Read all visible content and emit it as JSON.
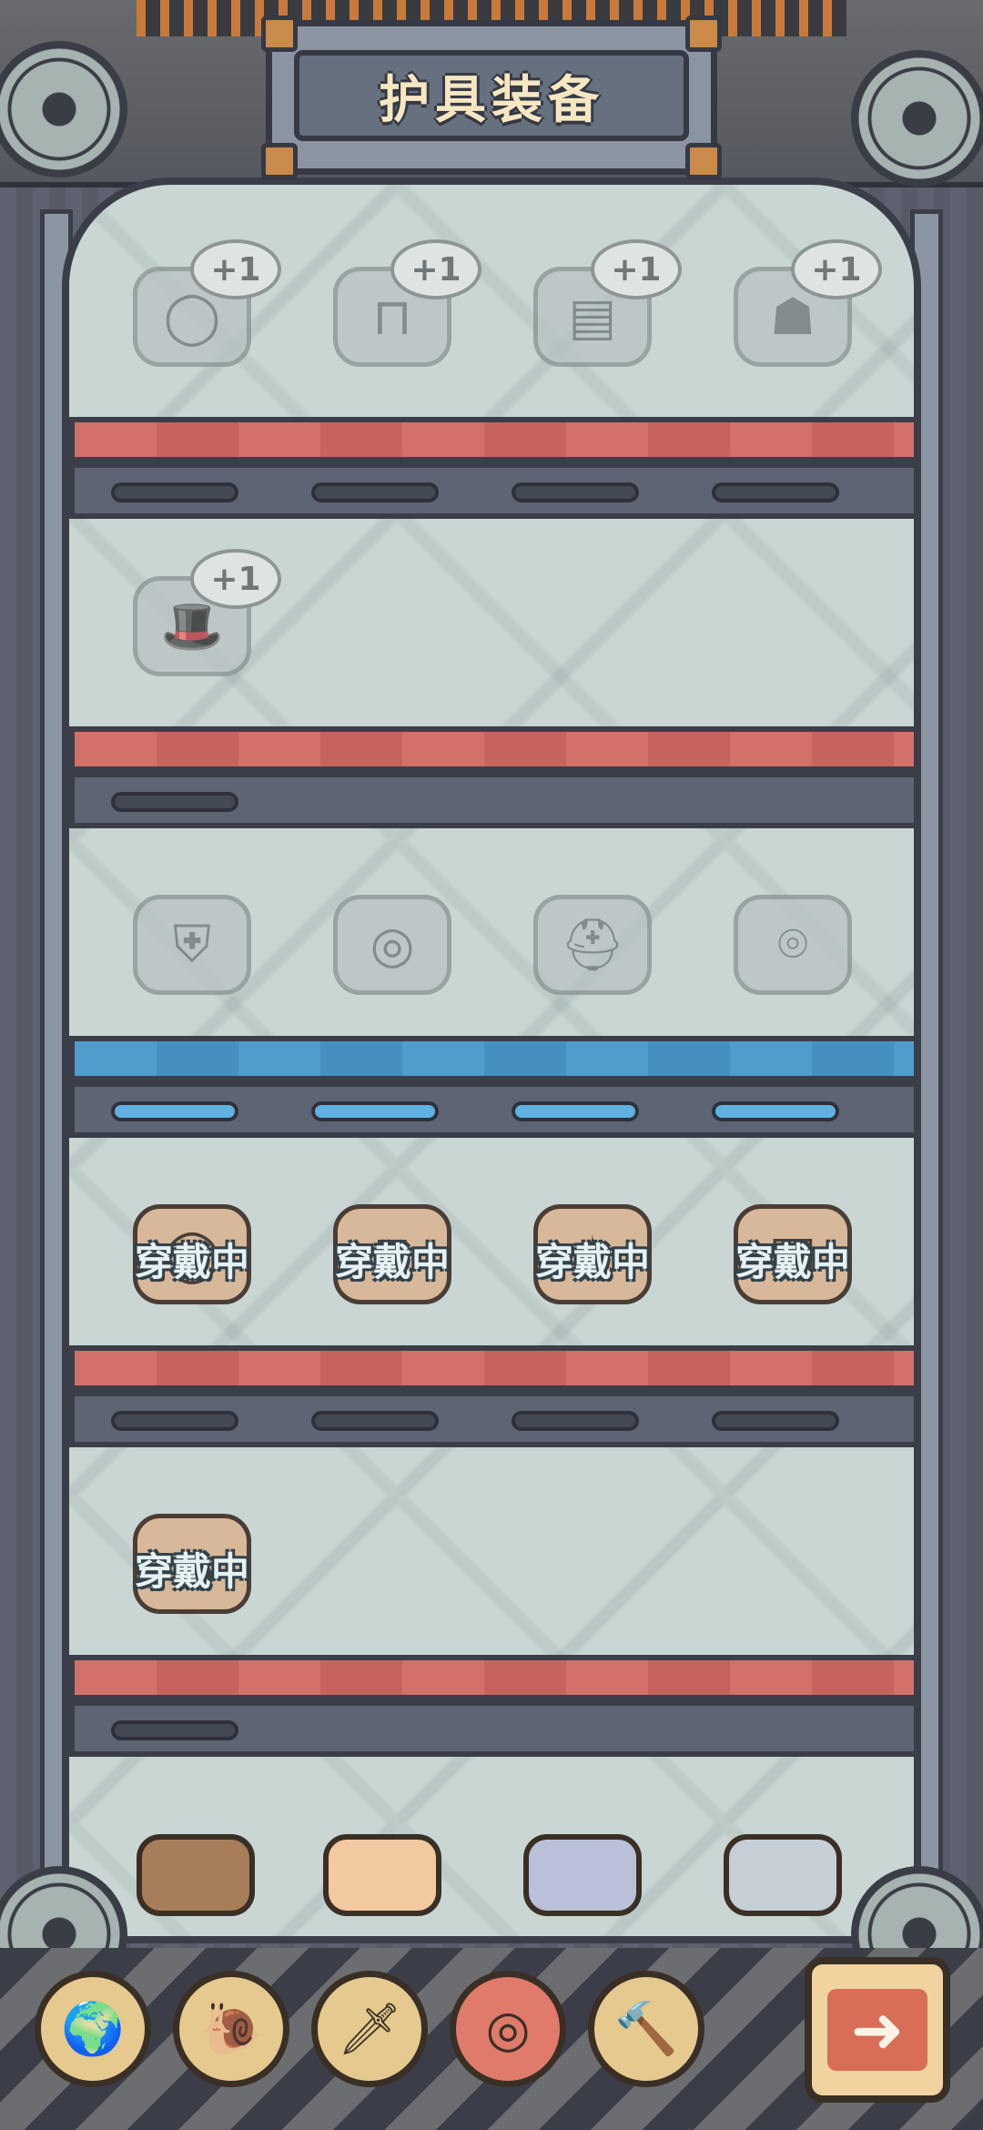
{
  "header": {
    "title": "护具装备"
  },
  "shelves": [
    {
      "board_color": "red",
      "slots": [
        {
          "name": "ring",
          "badge": "+1",
          "icon": "ring-icon"
        },
        {
          "name": "pants",
          "badge": "+1",
          "icon": "pants-icon"
        },
        {
          "name": "device",
          "badge": "+1",
          "icon": "device-icon"
        },
        {
          "name": "shirt",
          "badge": "+1",
          "icon": "shirt-icon"
        }
      ],
      "bars": [
        false,
        false,
        false,
        false
      ]
    },
    {
      "board_color": "red",
      "slots": [
        {
          "name": "top-hat",
          "badge": "+1",
          "icon": "hat-icon"
        }
      ],
      "bars": [
        false
      ]
    },
    {
      "board_color": "blue",
      "slots": [
        {
          "name": "armor",
          "icon": "armor-icon"
        },
        {
          "name": "swim-ring",
          "icon": "swim-ring-icon"
        },
        {
          "name": "viking-helmet",
          "icon": "helmet-icon"
        },
        {
          "name": "bracelet",
          "icon": "bracelet-icon"
        }
      ],
      "bars": [
        true,
        true,
        true,
        true
      ]
    },
    {
      "board_color": "red",
      "slots": [
        {
          "name": "ring-equipped",
          "label": "穿戴中",
          "icon": "ring-icon"
        },
        {
          "name": "pants-equipped",
          "label": "穿戴中",
          "icon": "pants-icon"
        },
        {
          "name": "wings-equipped",
          "label": "穿戴中",
          "icon": "wings-icon"
        },
        {
          "name": "device-equipped",
          "label": "穿戴中",
          "icon": "device-icon"
        }
      ],
      "bars": [
        false,
        false,
        false,
        false
      ]
    },
    {
      "board_color": "red",
      "slots": [
        {
          "name": "cake-equipped",
          "label": "穿戴中",
          "icon": "cake-icon"
        }
      ],
      "bars": [
        false
      ]
    }
  ],
  "toolbar": {
    "buttons": [
      {
        "name": "globe",
        "icon": "globe-icon",
        "glyph": "🌍"
      },
      {
        "name": "snail",
        "icon": "snail-icon",
        "glyph": "🐌"
      },
      {
        "name": "sword",
        "icon": "sword-icon",
        "glyph": "🗡"
      },
      {
        "name": "shield",
        "icon": "shield-icon",
        "glyph": "◎",
        "active": true
      },
      {
        "name": "hammer",
        "icon": "hammer-icon",
        "glyph": "🔨"
      }
    ],
    "next_glyph": "➜"
  },
  "colors": {
    "accent_red": "#d1716a",
    "accent_blue": "#4f9ccd",
    "title_text": "#f6e7c3"
  }
}
